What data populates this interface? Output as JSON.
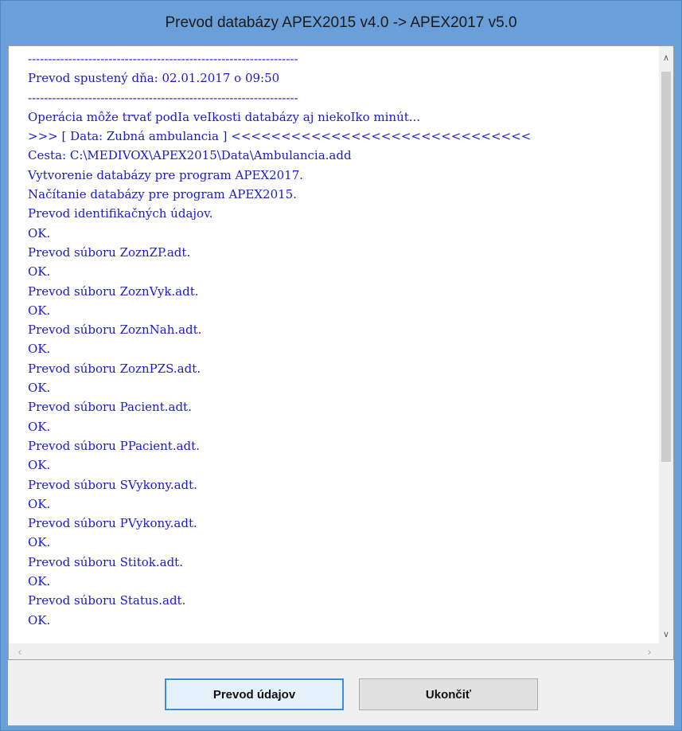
{
  "window": {
    "title": "Prevod databázy APEX2015 v4.0 -> APEX2017 v5.0"
  },
  "log": {
    "lines": [
      "-------------------------------------------------------------------",
      "Prevod spustený dňa: 02.01.2017 o 09:50",
      "-------------------------------------------------------------------",
      "Operácia môže trvať podIa veIkosti databázy aj niekoIko minút...",
      ">>> [ Data: Zubná ambulancia ] <<<<<<<<<<<<<<<<<<<<<<<<<<<<<<",
      "Cesta: C:\\MEDIVOX\\APEX2015\\Data\\Ambulancia.add",
      "Vytvorenie databázy pre program APEX2017.",
      "Načítanie databázy pre program APEX2015.",
      "Prevod identifikačných údajov.",
      "OK.",
      "Prevod súboru ZoznZP.adt.",
      "OK.",
      "Prevod súboru ZoznVyk.adt.",
      "OK.",
      "Prevod súboru ZoznNah.adt.",
      "OK.",
      "Prevod súboru ZoznPZS.adt.",
      "OK.",
      "Prevod súboru Pacient.adt.",
      "OK.",
      "Prevod súboru PPacient.adt.",
      "OK.",
      "Prevod súboru SVykony.adt.",
      "OK.",
      "Prevod súboru PVykony.adt.",
      "OK.",
      "Prevod súboru Stitok.adt.",
      "OK.",
      "Prevod súboru Status.adt.",
      "OK."
    ]
  },
  "scrollbars": {
    "up_icon": "chevron-up-icon",
    "down_icon": "chevron-down-icon",
    "left_icon": "chevron-left-icon",
    "right_icon": "chevron-right-icon"
  },
  "buttons": {
    "convert_label": "Prevod údajov",
    "exit_label": "Ukončiť"
  },
  "colors": {
    "titlebar": "#6aa0da",
    "log_text": "#1a1ad0",
    "default_button_border": "#3c8ddb"
  }
}
